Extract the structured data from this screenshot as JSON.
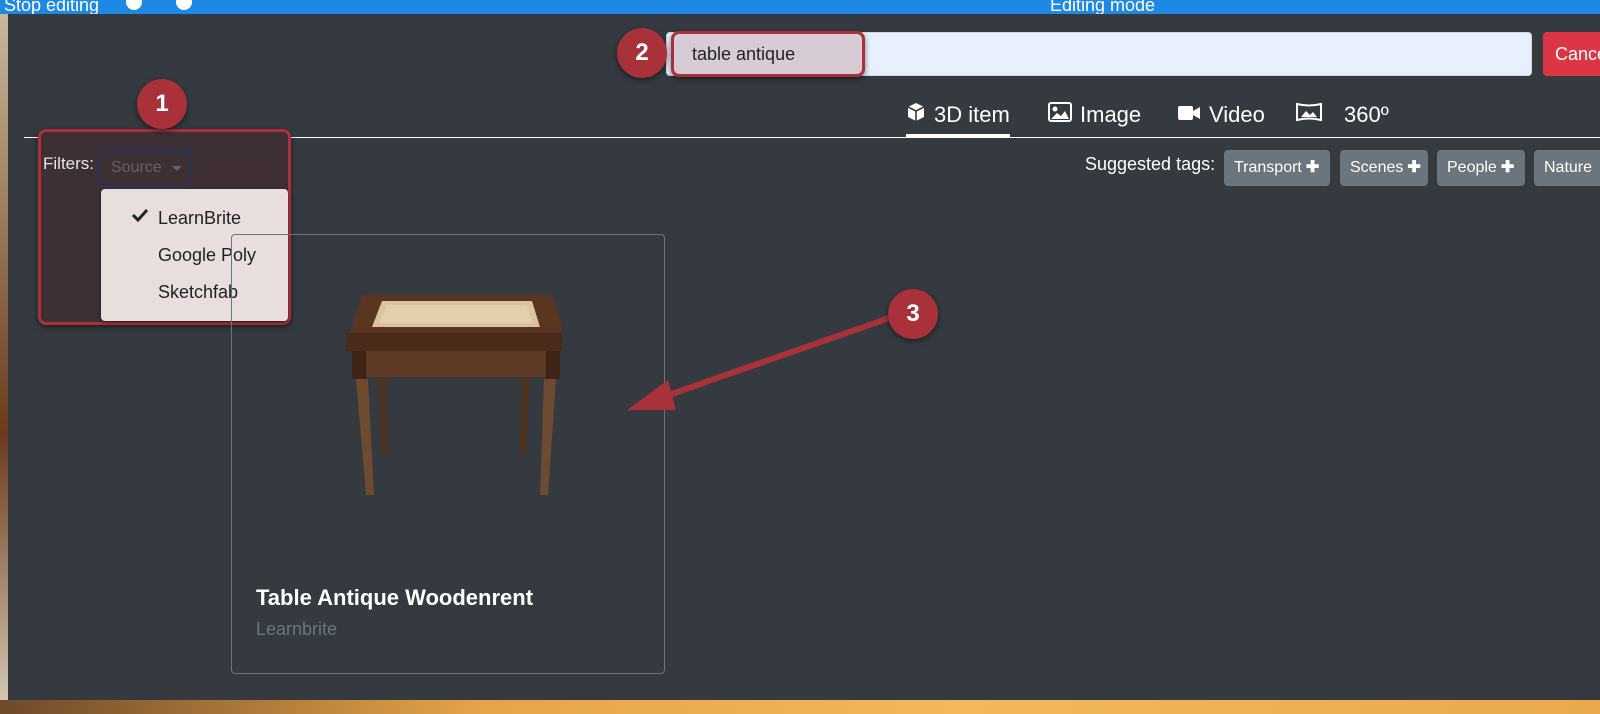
{
  "background": {
    "stop_editing_label": "Stop editing",
    "mode_label": "Editing mode"
  },
  "search": {
    "value": "table antique",
    "cancel_label": "Cancel"
  },
  "tabs": [
    {
      "label": "3D item",
      "icon": "cube-icon",
      "active": true
    },
    {
      "label": "Image",
      "icon": "image-icon",
      "active": false
    },
    {
      "label": "Video",
      "icon": "video-icon",
      "active": false
    },
    {
      "label": "360º",
      "icon": "panorama-icon",
      "active": false
    }
  ],
  "filters": {
    "label": "Filters:",
    "source_label": "Source",
    "options": [
      {
        "label": "LearnBrite",
        "checked": true
      },
      {
        "label": "Google Poly",
        "checked": false
      },
      {
        "label": "Sketchfab",
        "checked": false
      }
    ]
  },
  "suggested_tags": {
    "label": "Suggested tags:",
    "tags": [
      "Transport",
      "Scenes",
      "People",
      "Nature"
    ]
  },
  "results": [
    {
      "title": "Table Antique Woodenrent",
      "source": "Learnbrite"
    }
  ],
  "annotations": [
    "1",
    "2",
    "3"
  ],
  "colors": {
    "accent_red": "#a8313a",
    "cancel_red": "#dc3545",
    "panel_dark": "#343a40",
    "tag_gray": "#6c757d"
  }
}
